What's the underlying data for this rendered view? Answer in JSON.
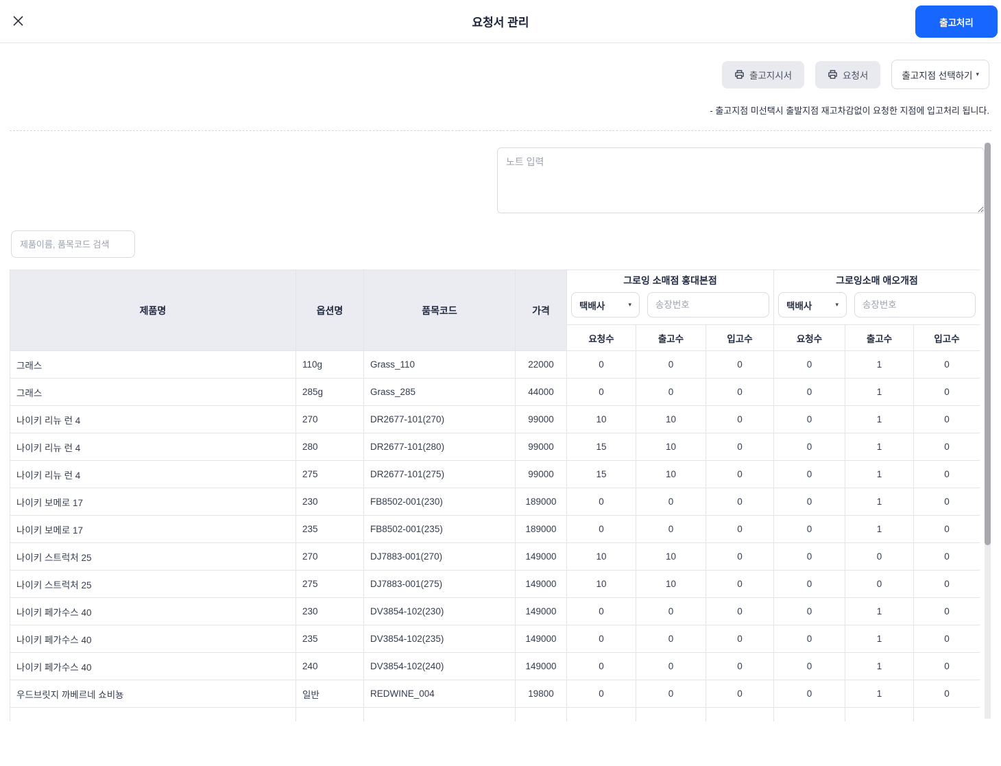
{
  "header": {
    "title": "요청서 관리",
    "submit_label": "출고처리"
  },
  "toolbar": {
    "print_order_label": "출고지시서",
    "print_request_label": "요청서",
    "select_branch_label": "출고지점 선택하기",
    "notice": "- 출고지점 미선택시 출발지점 재고차감없이 요청한 지점에 입고처리 됩니다."
  },
  "note": {
    "placeholder": "노트 입력"
  },
  "search": {
    "placeholder": "제품이름, 품목코드 검색"
  },
  "table": {
    "columns": {
      "product": "제품명",
      "option": "옵션명",
      "code": "품목코드",
      "price": "가격"
    },
    "sub_columns": {
      "requested": "요청수",
      "shipped": "출고수",
      "received": "입고수"
    },
    "stores": [
      {
        "name": "그로잉 소매점 홍대본점",
        "courier_label": "택배사",
        "invoice_placeholder": "송장번호"
      },
      {
        "name": "그로잉소매 애오개점",
        "courier_label": "택배사",
        "invoice_placeholder": "송장번호"
      }
    ],
    "rows": [
      {
        "product": "그래스",
        "option": "110g",
        "code": "Grass_110",
        "price": "22000",
        "store1": [
          "0",
          "0",
          "0"
        ],
        "store2": [
          "0",
          "1",
          "0"
        ]
      },
      {
        "product": "그래스",
        "option": "285g",
        "code": "Grass_285",
        "price": "44000",
        "store1": [
          "0",
          "0",
          "0"
        ],
        "store2": [
          "0",
          "1",
          "0"
        ]
      },
      {
        "product": "나이키 리뉴 런 4",
        "option": "270",
        "code": "DR2677-101(270)",
        "price": "99000",
        "store1": [
          "10",
          "10",
          "0"
        ],
        "store2": [
          "0",
          "1",
          "0"
        ]
      },
      {
        "product": "나이키 리뉴 런 4",
        "option": "280",
        "code": "DR2677-101(280)",
        "price": "99000",
        "store1": [
          "15",
          "10",
          "0"
        ],
        "store2": [
          "0",
          "1",
          "0"
        ]
      },
      {
        "product": "나이키 리뉴 런 4",
        "option": "275",
        "code": "DR2677-101(275)",
        "price": "99000",
        "store1": [
          "15",
          "10",
          "0"
        ],
        "store2": [
          "0",
          "1",
          "0"
        ]
      },
      {
        "product": "나이키 보메로 17",
        "option": "230",
        "code": "FB8502-001(230)",
        "price": "189000",
        "store1": [
          "0",
          "0",
          "0"
        ],
        "store2": [
          "0",
          "1",
          "0"
        ]
      },
      {
        "product": "나이키 보메로 17",
        "option": "235",
        "code": "FB8502-001(235)",
        "price": "189000",
        "store1": [
          "0",
          "0",
          "0"
        ],
        "store2": [
          "0",
          "1",
          "0"
        ]
      },
      {
        "product": "나이키 스트럭처 25",
        "option": "270",
        "code": "DJ7883-001(270)",
        "price": "149000",
        "store1": [
          "10",
          "10",
          "0"
        ],
        "store2": [
          "0",
          "0",
          "0"
        ]
      },
      {
        "product": "나이키 스트럭처 25",
        "option": "275",
        "code": "DJ7883-001(275)",
        "price": "149000",
        "store1": [
          "10",
          "10",
          "0"
        ],
        "store2": [
          "0",
          "0",
          "0"
        ]
      },
      {
        "product": "나이키 페가수스 40",
        "option": "230",
        "code": "DV3854-102(230)",
        "price": "149000",
        "store1": [
          "0",
          "0",
          "0"
        ],
        "store2": [
          "0",
          "1",
          "0"
        ]
      },
      {
        "product": "나이키 페가수스 40",
        "option": "235",
        "code": "DV3854-102(235)",
        "price": "149000",
        "store1": [
          "0",
          "0",
          "0"
        ],
        "store2": [
          "0",
          "1",
          "0"
        ]
      },
      {
        "product": "나이키 페가수스 40",
        "option": "240",
        "code": "DV3854-102(240)",
        "price": "149000",
        "store1": [
          "0",
          "0",
          "0"
        ],
        "store2": [
          "0",
          "1",
          "0"
        ]
      },
      {
        "product": "우드브릿지 까베르네 쇼비뇽",
        "option": "일반",
        "code": "REDWINE_004",
        "price": "19800",
        "store1": [
          "0",
          "0",
          "0"
        ],
        "store2": [
          "0",
          "1",
          "0"
        ]
      }
    ]
  },
  "colors": {
    "primary": "#1666ff",
    "header_bg": "#ebecf1",
    "button_gray": "#e9eaf0",
    "border": "#e3e4e9"
  }
}
